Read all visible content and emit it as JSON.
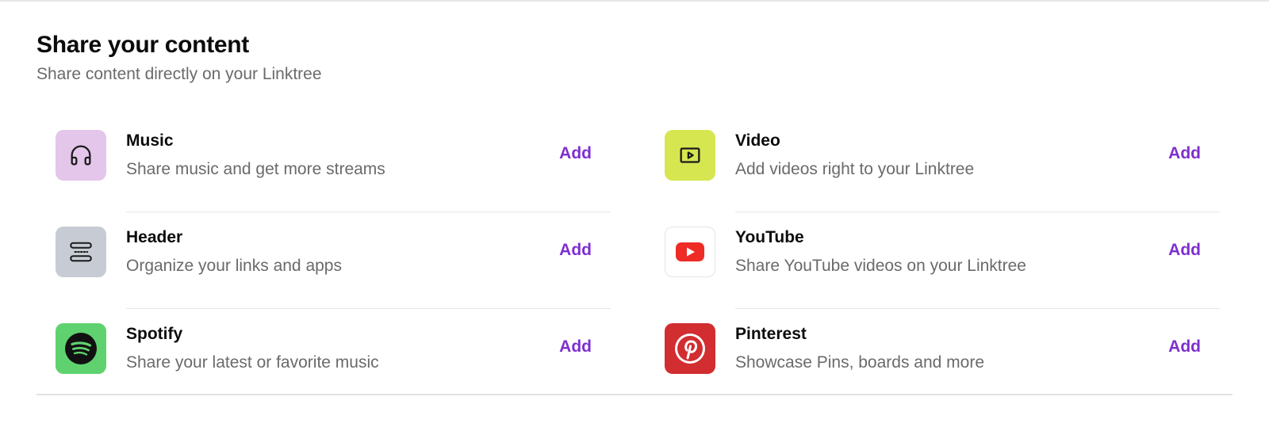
{
  "section": {
    "title": "Share your content",
    "subtitle": "Share content directly on your Linktree"
  },
  "items": [
    {
      "name": "Music",
      "description": "Share music and get more streams",
      "action": "Add",
      "icon": "headphones-icon",
      "tile_color": "#e4c6ea"
    },
    {
      "name": "Video",
      "description": "Add videos right to your Linktree",
      "action": "Add",
      "icon": "video-play-icon",
      "tile_color": "#d6e650"
    },
    {
      "name": "Header",
      "description": "Organize your links and apps",
      "action": "Add",
      "icon": "header-icon",
      "tile_color": "#c7ccd4"
    },
    {
      "name": "YouTube",
      "description": "Share YouTube videos on your Linktree",
      "action": "Add",
      "icon": "youtube-icon",
      "tile_color": "#ffffff"
    },
    {
      "name": "Spotify",
      "description": "Share your latest or favorite music",
      "action": "Add",
      "icon": "spotify-icon",
      "tile_color": "#5fd26f"
    },
    {
      "name": "Pinterest",
      "description": "Showcase Pins, boards and more",
      "action": "Add",
      "icon": "pinterest-icon",
      "tile_color": "#d22d30"
    }
  ],
  "accent_color": "#7e2fd0"
}
